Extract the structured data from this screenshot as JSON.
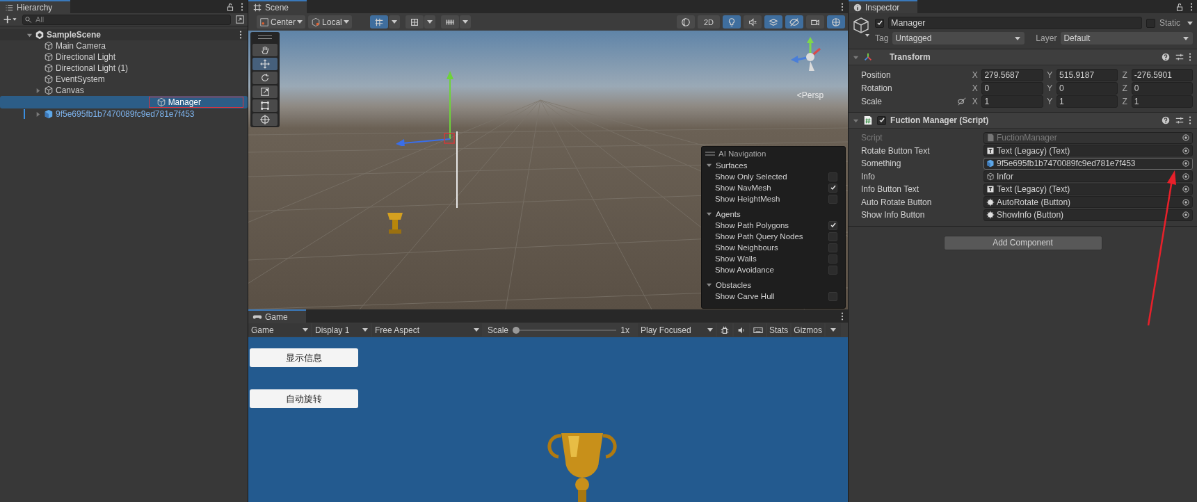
{
  "hierarchy": {
    "title": "Hierarchy",
    "search": {
      "placeholder": "All"
    },
    "scene": {
      "name": "SampleScene",
      "expanded": true,
      "children": [
        {
          "name": "Main Camera",
          "kind": "object",
          "selected": false,
          "marked": false
        },
        {
          "name": "Directional Light",
          "kind": "object",
          "selected": false,
          "marked": false
        },
        {
          "name": "Directional Light (1)",
          "kind": "object",
          "selected": false,
          "marked": false
        },
        {
          "name": "EventSystem",
          "kind": "object",
          "selected": false,
          "marked": false
        },
        {
          "name": "Canvas",
          "kind": "object",
          "expanded": false,
          "selected": false,
          "marked": false
        },
        {
          "name": "Manager",
          "kind": "object",
          "selected": true,
          "marked": true
        },
        {
          "name": "9f5e695fb1b7470089fc9ed781e7f453",
          "kind": "prefab",
          "expanded": false,
          "selected": false,
          "marked": false
        }
      ]
    }
  },
  "scene": {
    "title": "Scene",
    "pivot": "Center",
    "space": "Local",
    "left_toggles": [
      {
        "kind": "grid",
        "on": true
      },
      {
        "kind": "snap",
        "on": false
      },
      {
        "kind": "increment",
        "on": false
      }
    ],
    "right_toggles": [
      {
        "kind": "shading",
        "on": false
      },
      {
        "kind": "dimension",
        "label": "2D",
        "on": false
      },
      {
        "kind": "lighting",
        "on": true
      },
      {
        "kind": "audio",
        "on": false
      },
      {
        "kind": "effects",
        "on": true
      },
      {
        "kind": "visibility",
        "on": true
      },
      {
        "kind": "camera",
        "on": false
      },
      {
        "kind": "gizmos",
        "on": true
      }
    ],
    "tools": [
      {
        "kind": "hand",
        "selected": false
      },
      {
        "kind": "move",
        "selected": true
      },
      {
        "kind": "rotate",
        "selected": false
      },
      {
        "kind": "scale",
        "selected": false
      },
      {
        "kind": "rect",
        "selected": false
      },
      {
        "kind": "transform",
        "selected": false
      }
    ],
    "projection": "<Persp",
    "ai_navigation": {
      "title": "AI Navigation",
      "sections": [
        {
          "title": "Surfaces",
          "items": [
            {
              "label": "Show Only Selected",
              "checked": false
            },
            {
              "label": "Show NavMesh",
              "checked": true
            },
            {
              "label": "Show HeightMesh",
              "checked": false
            }
          ]
        },
        {
          "title": "Agents",
          "items": [
            {
              "label": "Show Path Polygons",
              "checked": true
            },
            {
              "label": "Show Path Query Nodes",
              "checked": false
            },
            {
              "label": "Show Neighbours",
              "checked": false
            },
            {
              "label": "Show Walls",
              "checked": false
            },
            {
              "label": "Show Avoidance",
              "checked": false
            }
          ]
        },
        {
          "title": "Obstacles",
          "items": [
            {
              "label": "Show Carve Hull",
              "checked": false
            }
          ]
        }
      ]
    }
  },
  "game": {
    "title": "Game",
    "view": "Game",
    "display": "Display 1",
    "aspect": "Free Aspect",
    "scale_label": "Scale",
    "scale": {
      "level": 0
    },
    "scale_reading": "1x",
    "play_mode": "Play Focused",
    "stats": "Stats",
    "gizmos": "Gizmos",
    "buttons": [
      "显示信息",
      "自动旋转"
    ]
  },
  "inspector": {
    "title": "Inspector",
    "object": {
      "name": "Manager",
      "active": true,
      "static_label": "Static",
      "static": false,
      "tag_label": "Tag",
      "tag": "Untagged",
      "layer_label": "Layer",
      "layer": "Default"
    },
    "transform": {
      "title": "Transform",
      "rows": [
        {
          "label": "Position",
          "linked": false,
          "values": [
            {
              "axis": "X",
              "value": "279.5687"
            },
            {
              "axis": "Y",
              "value": "515.9187"
            },
            {
              "axis": "Z",
              "value": "-276.5901"
            }
          ]
        },
        {
          "label": "Rotation",
          "linked": false,
          "values": [
            {
              "axis": "X",
              "value": "0"
            },
            {
              "axis": "Y",
              "value": "0"
            },
            {
              "axis": "Z",
              "value": "0"
            }
          ]
        },
        {
          "label": "Scale",
          "linked": true,
          "values": [
            {
              "axis": "X",
              "value": "1"
            },
            {
              "axis": "Y",
              "value": "1"
            },
            {
              "axis": "Z",
              "value": "1"
            }
          ]
        }
      ]
    },
    "component": {
      "title": "Fuction Manager (Script)",
      "enabled": true,
      "fields": [
        {
          "label": "Script",
          "value": "FuctionManager",
          "kind": "script",
          "disabled": true
        },
        {
          "label": "Rotate Button Text",
          "value": "Text (Legacy) (Text)",
          "kind": "text",
          "disabled": false
        },
        {
          "label": "Something",
          "value": "9f5e695fb1b7470089fc9ed781e7f453",
          "kind": "prefab",
          "disabled": false
        },
        {
          "label": "Info",
          "value": "Infor",
          "kind": "object",
          "disabled": false
        },
        {
          "label": "Info Button Text",
          "value": "Text (Legacy) (Text)",
          "kind": "text",
          "disabled": false
        },
        {
          "label": "Auto Rotate Button",
          "value": "AutoRotate (Button)",
          "kind": "button",
          "disabled": false
        },
        {
          "label": "Show Info Button",
          "value": "ShowInfo (Button)",
          "kind": "button",
          "disabled": false
        }
      ]
    },
    "add_component": "Add Component"
  }
}
